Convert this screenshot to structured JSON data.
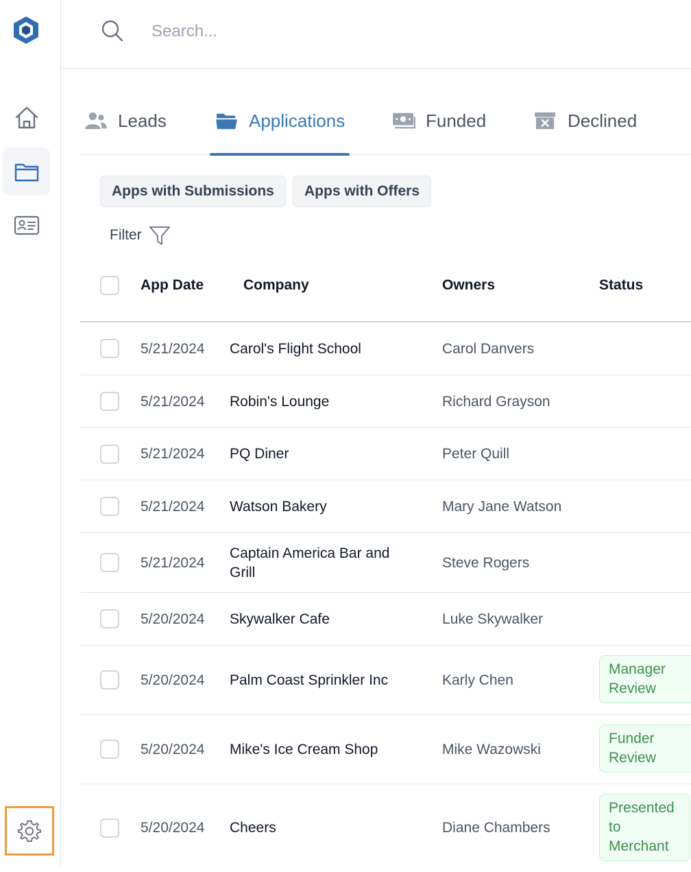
{
  "search": {
    "placeholder": "Search..."
  },
  "sidebar": {
    "items": [
      {
        "name": "home",
        "icon": "home-icon"
      },
      {
        "name": "applications",
        "icon": "folder-icon",
        "active": true
      },
      {
        "name": "contacts",
        "icon": "id-card-icon"
      }
    ],
    "settings_icon": "gear-icon"
  },
  "tabs": [
    {
      "label": "Leads",
      "icon": "users-icon"
    },
    {
      "label": "Applications",
      "icon": "folder-open-icon",
      "active": true
    },
    {
      "label": "Funded",
      "icon": "money-icon"
    },
    {
      "label": "Declined",
      "icon": "archive-x-icon"
    }
  ],
  "chips": [
    "Apps with Submissions",
    "Apps with Offers"
  ],
  "filter": {
    "label": "Filter",
    "icon": "funnel-icon"
  },
  "table": {
    "headers": {
      "date": "App Date",
      "company": "Company",
      "owners": "Owners",
      "status": "Status"
    },
    "rows": [
      {
        "date": "5/21/2024",
        "company": "Carol's Flight School",
        "owner": "Carol Danvers",
        "status": ""
      },
      {
        "date": "5/21/2024",
        "company": "Robin's Lounge",
        "owner": "Richard Grayson",
        "status": ""
      },
      {
        "date": "5/21/2024",
        "company": "PQ Diner",
        "owner": "Peter Quill",
        "status": ""
      },
      {
        "date": "5/21/2024",
        "company": "Watson Bakery",
        "owner": "Mary Jane Watson",
        "status": ""
      },
      {
        "date": "5/21/2024",
        "company": "Captain America Bar and Grill",
        "owner": "Steve Rogers",
        "status": ""
      },
      {
        "date": "5/20/2024",
        "company": "Skywalker Cafe",
        "owner": "Luke Skywalker",
        "status": ""
      },
      {
        "date": "5/20/2024",
        "company": "Palm Coast Sprinkler Inc",
        "owner": "Karly Chen",
        "status": "Manager Review"
      },
      {
        "date": "5/20/2024",
        "company": "Mike's Ice Cream Shop",
        "owner": "Mike Wazowski",
        "status": "Funder Review"
      },
      {
        "date": "5/20/2024",
        "company": "Cheers",
        "owner": "Diane Chambers",
        "status": "Presented to Merchant"
      }
    ]
  },
  "colors": {
    "accent": "#3a78b5",
    "settings_highlight": "#f19a3e",
    "status_green": "#3f8f4f"
  }
}
